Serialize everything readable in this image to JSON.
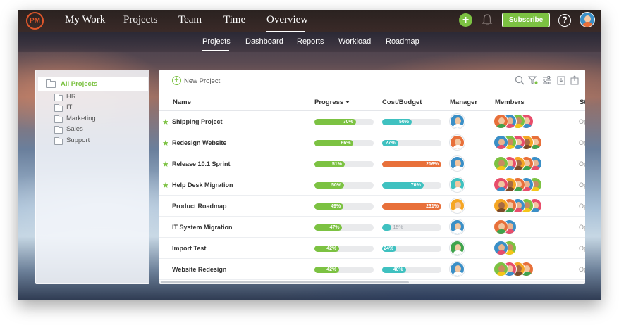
{
  "topnav": {
    "logo": "PM",
    "items": [
      "My Work",
      "Projects",
      "Team",
      "Time",
      "Overview"
    ],
    "active": "Overview",
    "subscribe_label": "Subscribe",
    "help_label": "?"
  },
  "subnav": {
    "items": [
      "Projects",
      "Dashboard",
      "Reports",
      "Workload",
      "Roadmap"
    ],
    "active": "Projects"
  },
  "sidebar": {
    "root": "All Projects",
    "children": [
      "HR",
      "IT",
      "Marketing",
      "Sales",
      "Support"
    ]
  },
  "toolbar": {
    "new_project_label": "New Project",
    "icons": [
      "search-icon",
      "filter-icon",
      "settings-sliders-icon",
      "import-icon",
      "export-icon"
    ]
  },
  "table": {
    "columns": [
      "Name",
      "Progress",
      "Cost/Budget",
      "Manager",
      "Members",
      "St"
    ],
    "rows": [
      {
        "starred": true,
        "name": "Shipping Project",
        "progress": "70%",
        "cost": "50%",
        "cost_color": "#3fc1c0",
        "status": "Op"
      },
      {
        "starred": true,
        "name": "Redesign Website",
        "progress": "66%",
        "cost": "27%",
        "cost_color": "#3fc1c0",
        "status": "Op"
      },
      {
        "starred": true,
        "name": "Release 10.1 Sprint",
        "progress": "51%",
        "cost": "216%",
        "cost_color": "#e8703a",
        "status": "Op"
      },
      {
        "starred": true,
        "name": "Help Desk Migration",
        "progress": "50%",
        "cost": "70%",
        "cost_color": "#3fc1c0",
        "status": "Op"
      },
      {
        "starred": false,
        "name": "Product Roadmap",
        "progress": "49%",
        "cost": "231%",
        "cost_color": "#e8703a",
        "status": "Op"
      },
      {
        "starred": false,
        "name": "IT System Migration",
        "progress": "47%",
        "cost": "15%",
        "cost_color": "#3fc1c0",
        "status": "Op"
      },
      {
        "starred": false,
        "name": "Import Test",
        "progress": "42%",
        "cost": "24%",
        "cost_color": "#3fc1c0",
        "status": "Op"
      },
      {
        "starred": false,
        "name": "Website Redesign",
        "progress": "42%",
        "cost": "40%",
        "cost_color": "#3fc1c0",
        "status": "Op"
      }
    ]
  },
  "colors": {
    "accent": "#7cc242",
    "progress_bar": "#7cc242",
    "cost_ok": "#3fc1c0",
    "cost_over": "#e8703a",
    "logo": "#e0572b"
  }
}
